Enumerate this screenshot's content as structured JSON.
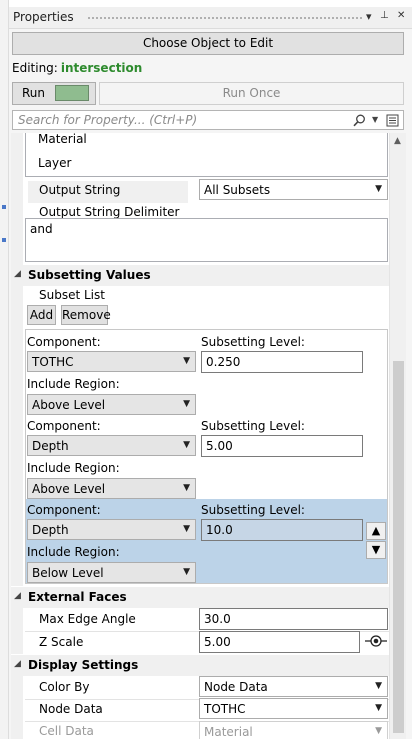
{
  "window": {
    "title": "Properties",
    "dropdown_icon": "▾",
    "pin_icon": "⊥",
    "close_icon": "✕"
  },
  "choose_button": "Choose Object to Edit",
  "editing": {
    "label": "Editing:",
    "value": "intersection"
  },
  "run": {
    "label": "Run",
    "swatch_color": "#8fbc8f",
    "run_once_label": "Run Once"
  },
  "search": {
    "placeholder": "Search for Property... (Ctrl+P)"
  },
  "list_items": [
    "Material",
    "Layer"
  ],
  "output_string": {
    "label": "Output String",
    "value": "All Subsets"
  },
  "output_delimiter": {
    "label": "Output String Delimiter",
    "value": "and"
  },
  "subsetting": {
    "header": "Subsetting Values",
    "subset_list_label": "Subset List",
    "add_label": "Add",
    "remove_label": "Remove",
    "entries": [
      {
        "component_label": "Component:",
        "component": "TOTHC",
        "level_label": "Subsetting Level:",
        "level": "0.250",
        "region_label": "Include Region:",
        "region": "Above Level"
      },
      {
        "component_label": "Component:",
        "component": "Depth",
        "level_label": "Subsetting Level:",
        "level": "5.00",
        "region_label": "Include Region:",
        "region": "Above Level"
      },
      {
        "component_label": "Component:",
        "component": "Depth",
        "level_label": "Subsetting Level:",
        "level": "10.0",
        "region_label": "Include Region:",
        "region": "Below Level"
      }
    ],
    "move_up": "▲",
    "move_down": "▼"
  },
  "external_faces": {
    "header": "External Faces",
    "max_edge_angle_label": "Max Edge Angle",
    "max_edge_angle": "30.0",
    "z_scale_label": "Z Scale",
    "z_scale": "5.00"
  },
  "display_settings": {
    "header": "Display Settings",
    "color_by_label": "Color By",
    "color_by": "Node Data",
    "node_data_label": "Node Data",
    "node_data": "TOTHC",
    "cell_data_label": "Cell Data",
    "cell_data": "Material"
  }
}
